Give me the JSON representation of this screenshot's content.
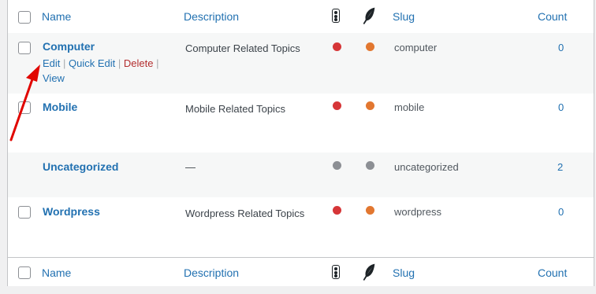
{
  "columns": {
    "name": "Name",
    "description": "Description",
    "slug": "Slug",
    "count": "Count"
  },
  "icons": {
    "traffic_light": "traffic-light-icon",
    "feather": "feather-icon"
  },
  "colors": {
    "red": "#d63638",
    "orange": "#e27730",
    "gray": "#8c8f94",
    "link": "#2271b1"
  },
  "rows": [
    {
      "name": "Computer",
      "description": "Computer Related Topics",
      "slug": "computer",
      "count": "0",
      "status1": "red",
      "status2": "orange",
      "actions": {
        "edit": "Edit",
        "quick_edit": "Quick Edit",
        "delete": "Delete",
        "view": "View"
      }
    },
    {
      "name": "Mobile",
      "description": "Mobile Related Topics",
      "slug": "mobile",
      "count": "0",
      "status1": "red",
      "status2": "orange"
    },
    {
      "name": "Uncategorized",
      "description": "—",
      "slug": "uncategorized",
      "count": "2",
      "status1": "gray",
      "status2": "gray"
    },
    {
      "name": "Wordpress",
      "description": "Wordpress Related Topics",
      "slug": "wordpress",
      "count": "0",
      "status1": "red",
      "status2": "orange"
    }
  ]
}
